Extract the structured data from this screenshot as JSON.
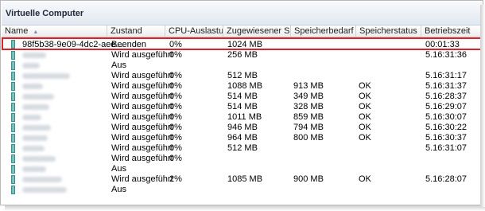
{
  "panel": {
    "title": "Virtuelle Computer"
  },
  "columns": [
    {
      "label": "Name"
    },
    {
      "label": "Zustand"
    },
    {
      "label": "CPU-Auslastu..."
    },
    {
      "label": "Zugewiesener S..."
    },
    {
      "label": "Speicherbedarf"
    },
    {
      "label": "Speicherstatus"
    },
    {
      "label": "Betriebszeit"
    }
  ],
  "rows": [
    {
      "name": "98f5b38-9e09-4dc2-aee...",
      "state": "Beenden",
      "state2": "",
      "cpu": "0%",
      "mem": "1024 MB",
      "demand": "",
      "status": "",
      "uptime": "00:01:33",
      "selected": true
    },
    {
      "name": "",
      "state": "Wird ausgeführt",
      "state2": "Aus",
      "cpu": "0%",
      "mem": "256 MB",
      "demand": "",
      "status": "",
      "uptime": "5.16:31:36"
    },
    {
      "name": "",
      "state": "Wird ausgeführt",
      "state2": "",
      "cpu": "0%",
      "mem": "512 MB",
      "demand": "",
      "status": "",
      "uptime": "5.16:31:17"
    },
    {
      "name": "",
      "state": "Wird ausgeführt",
      "state2": "",
      "cpu": "0%",
      "mem": "1088 MB",
      "demand": "913 MB",
      "status": "OK",
      "uptime": "5.16:31:37"
    },
    {
      "name": "",
      "state": "Wird ausgeführt",
      "state2": "",
      "cpu": "0%",
      "mem": "514 MB",
      "demand": "349 MB",
      "status": "OK",
      "uptime": "5.16:28:37"
    },
    {
      "name": "",
      "state": "Wird ausgeführt",
      "state2": "",
      "cpu": "0%",
      "mem": "514 MB",
      "demand": "328 MB",
      "status": "OK",
      "uptime": "5.16:29:07"
    },
    {
      "name": "",
      "state": "Wird ausgeführt",
      "state2": "",
      "cpu": "0%",
      "mem": "1011 MB",
      "demand": "859 MB",
      "status": "OK",
      "uptime": "5.16:30:07"
    },
    {
      "name": "",
      "state": "Wird ausgeführt",
      "state2": "",
      "cpu": "0%",
      "mem": "946 MB",
      "demand": "794 MB",
      "status": "OK",
      "uptime": "5.16:30:22"
    },
    {
      "name": "",
      "state": "Wird ausgeführt",
      "state2": "",
      "cpu": "0%",
      "mem": "964 MB",
      "demand": "800 MB",
      "status": "OK",
      "uptime": "5.16:30:37"
    },
    {
      "name": "",
      "state": "Wird ausgeführt",
      "state2": "",
      "cpu": "0%",
      "mem": "512 MB",
      "demand": "",
      "status": "",
      "uptime": "5.16:31:07"
    },
    {
      "name": "",
      "state": "Wird ausgeführt",
      "state2": "Aus",
      "cpu": "0%",
      "mem": "",
      "demand": "",
      "status": "",
      "uptime": ""
    },
    {
      "name": "",
      "state": "Wird ausgeführt",
      "state2": "Aus",
      "cpu": "2%",
      "mem": "1085 MB",
      "demand": "900 MB",
      "status": "OK",
      "uptime": "5.16:28:07"
    }
  ],
  "icons": {
    "vm": "virtual-machine-icon",
    "sort": "sort-ascending-icon"
  }
}
